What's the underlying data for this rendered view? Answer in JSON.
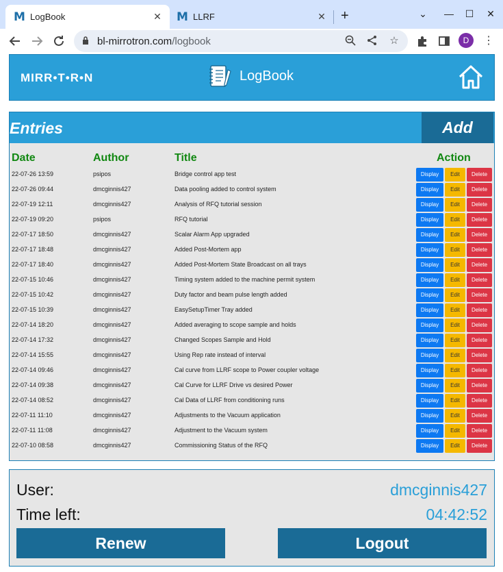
{
  "browser": {
    "tabs": [
      {
        "label": "LogBook",
        "favicon": "M",
        "active": true
      },
      {
        "label": "LLRF",
        "favicon": "M",
        "active": false
      }
    ],
    "url_host": "bl-mirrotron.com",
    "url_path": "/logbook",
    "profile_initial": "D",
    "new_tab_glyph": "+",
    "close_glyph": "✕"
  },
  "header": {
    "brand": "MIRR•T•R•N",
    "title": "LogBook"
  },
  "entries": {
    "title": "Entries",
    "add_label": "Add",
    "columns": {
      "date": "Date",
      "author": "Author",
      "title": "Title",
      "action": "Action"
    },
    "action_labels": {
      "display": "Display",
      "edit": "Edit",
      "delete": "Delete"
    },
    "rows": [
      {
        "date": "22-07-26 13:59",
        "author": "psipos",
        "title": "Bridge control app test"
      },
      {
        "date": "22-07-26 09:44",
        "author": "dmcginnis427",
        "title": "Data pooling added to control system"
      },
      {
        "date": "22-07-19 12:11",
        "author": "dmcginnis427",
        "title": "Analysis of RFQ tutorial session"
      },
      {
        "date": "22-07-19 09:20",
        "author": "psipos",
        "title": "RFQ tutorial"
      },
      {
        "date": "22-07-17 18:50",
        "author": "dmcginnis427",
        "title": "Scalar Alarm App upgraded"
      },
      {
        "date": "22-07-17 18:48",
        "author": "dmcginnis427",
        "title": "Added Post-Mortem app"
      },
      {
        "date": "22-07-17 18:40",
        "author": "dmcginnis427",
        "title": "Added Post-Mortem State Broadcast on all trays"
      },
      {
        "date": "22-07-15 10:46",
        "author": "dmcginnis427",
        "title": "Timing system added to the machine permit system"
      },
      {
        "date": "22-07-15 10:42",
        "author": "dmcginnis427",
        "title": "Duty factor and beam pulse length added"
      },
      {
        "date": "22-07-15 10:39",
        "author": "dmcginnis427",
        "title": "EasySetupTimer Tray added"
      },
      {
        "date": "22-07-14 18:20",
        "author": "dmcginnis427",
        "title": "Added averaging to scope sample and holds"
      },
      {
        "date": "22-07-14 17:32",
        "author": "dmcginnis427",
        "title": "Changed Scopes Sample and Hold"
      },
      {
        "date": "22-07-14 15:55",
        "author": "dmcginnis427",
        "title": "Using Rep rate instead of interval"
      },
      {
        "date": "22-07-14 09:46",
        "author": "dmcginnis427",
        "title": "Cal curve from LLRF scope to Power coupler voltage"
      },
      {
        "date": "22-07-14 09:38",
        "author": "dmcginnis427",
        "title": "Cal Curve for LLRF Drive vs desired Power"
      },
      {
        "date": "22-07-14 08:52",
        "author": "dmcginnis427",
        "title": "Cal Data of LLRF from conditioning runs"
      },
      {
        "date": "22-07-11 11:10",
        "author": "dmcginnis427",
        "title": "Adjustments to the Vacuum application"
      },
      {
        "date": "22-07-11 11:08",
        "author": "dmcginnis427",
        "title": "Adjustment to the Vacuum system"
      },
      {
        "date": "22-07-10 08:58",
        "author": "dmcginnis427",
        "title": "Commissioning Status of the RFQ"
      }
    ]
  },
  "status": {
    "user_label": "User:",
    "user_value": "dmcginnis427",
    "time_label": "Time left:",
    "time_value": "04:42:52",
    "renew_label": "Renew",
    "logout_label": "Logout"
  },
  "colors": {
    "header_blue": "#2a9fd8",
    "button_dark_blue": "#1a6b96",
    "column_header_green": "#118811",
    "display_blue": "#0d79f2",
    "edit_yellow": "#f5b800",
    "delete_red": "#dc3545"
  },
  "icons": [
    "back-arrow-icon",
    "forward-arrow-icon",
    "reload-icon",
    "lock-icon",
    "zoom-out-icon",
    "share-icon",
    "star-icon",
    "extensions-icon",
    "side-panel-icon",
    "kebab-menu-icon",
    "notebook-icon",
    "home-icon"
  ]
}
